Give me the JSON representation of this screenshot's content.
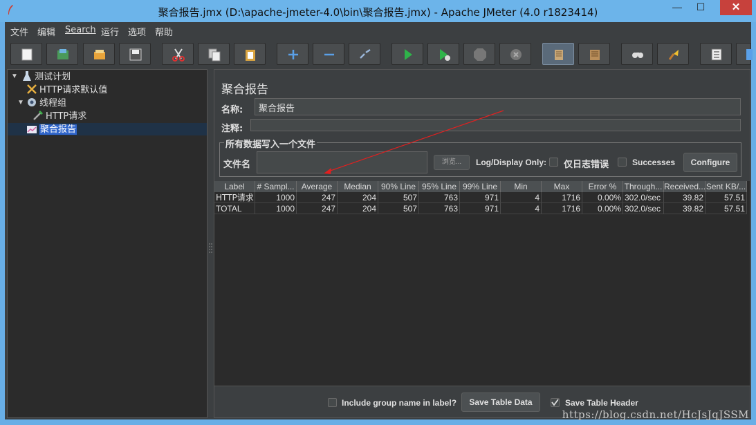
{
  "window": {
    "title": "聚合报告.jmx (D:\\apache-jmeter-4.0\\bin\\聚合报告.jmx) - Apache JMeter (4.0 r1823414)",
    "minimize": "—",
    "maximize": "☐",
    "close": "✕"
  },
  "menu": [
    "文件",
    "编辑",
    "Search",
    "运行",
    "选项",
    "帮助"
  ],
  "toolbar_icons": [
    "new-icon",
    "templates-icon",
    "open-icon",
    "save-icon",
    "cut-icon",
    "copy-icon",
    "paste-icon",
    "expand-icon",
    "collapse-icon",
    "toggle-icon",
    "start-icon",
    "start-no-timers-icon",
    "stop-icon",
    "shutdown-icon",
    "clear-icon",
    "clear-all-icon",
    "search-icon",
    "reset-search-icon",
    "function-helper-icon",
    "help-icon"
  ],
  "tree": {
    "items": [
      {
        "label": "测试计划",
        "icon": "test-plan-icon"
      },
      {
        "label": "HTTP请求默认值",
        "icon": "config-icon"
      },
      {
        "label": "线程组",
        "icon": "thread-group-icon"
      },
      {
        "label": "HTTP请求",
        "icon": "sampler-icon"
      },
      {
        "label": "聚合报告",
        "icon": "listener-icon"
      }
    ]
  },
  "panel": {
    "title": "聚合报告",
    "name_label": "名称:",
    "name_value": "聚合报告",
    "comment_label": "注释:",
    "comment_value": "",
    "file_group_title": "所有数据写入一个文件",
    "filename_label": "文件名",
    "filename_value": "",
    "browse_label": "浏览...",
    "log_display_label": "Log/Display Only:",
    "errors_only_label": "仅日志错误",
    "successes_label": "Successes",
    "configure_label": "Configure"
  },
  "table": {
    "columns": [
      "Label",
      "# Sampl...",
      "Average",
      "Median",
      "90% Line",
      "95% Line",
      "99% Line",
      "Min",
      "Max",
      "Error %",
      "Through...",
      "Received...",
      "Sent KB/..."
    ],
    "rows": [
      [
        "HTTP请求",
        "1000",
        "247",
        "204",
        "507",
        "763",
        "971",
        "4",
        "1716",
        "0.00%",
        "302.0/sec",
        "39.82",
        "57.51"
      ],
      [
        "TOTAL",
        "1000",
        "247",
        "204",
        "507",
        "763",
        "971",
        "4",
        "1716",
        "0.00%",
        "302.0/sec",
        "39.82",
        "57.51"
      ]
    ]
  },
  "bottom": {
    "include_group_label": "Include group name in label?",
    "save_table_data": "Save Table Data",
    "save_table_header": "Save Table Header"
  },
  "watermark": "https://blog.csdn.net/HcJsJqJSSM",
  "colors": {
    "background": "#3c3f41",
    "selection": "#1f3247",
    "annotation_arrow": "#e02020"
  }
}
